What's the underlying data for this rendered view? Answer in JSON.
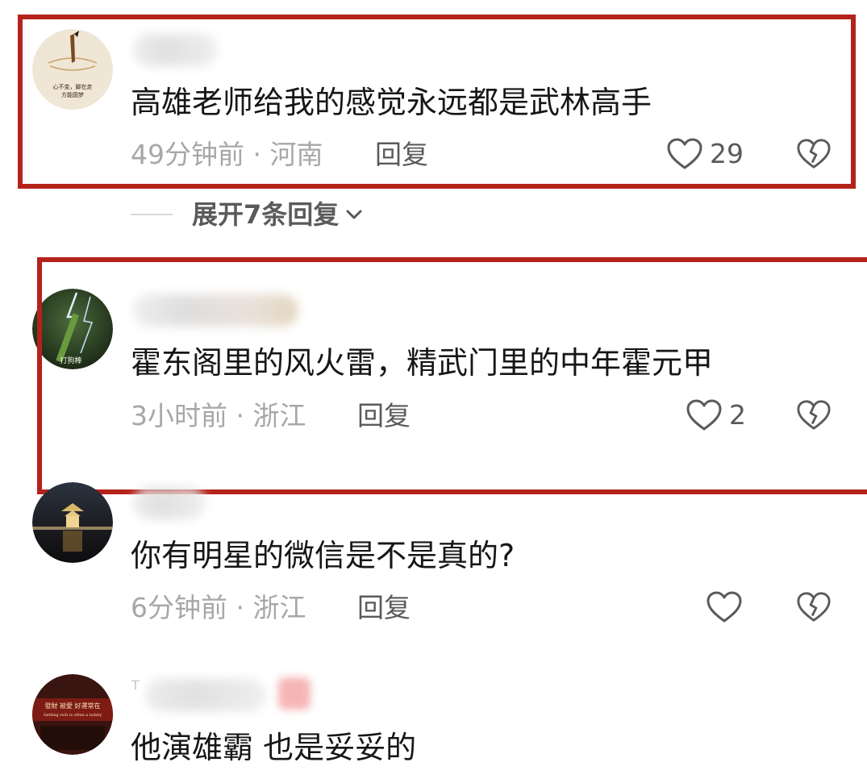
{
  "comments": [
    {
      "avatar_text": [
        "心不变，脚在走",
        "方能圆梦"
      ],
      "text": "高雄老师给我的感觉永远都是武林高手",
      "time": "49分钟前",
      "location": "河南",
      "reply_label": "回复",
      "likes": "29",
      "highlighted": true
    },
    {
      "avatar_text": [
        "打狗棒"
      ],
      "text": "霍东阁里的风火雷，精武门里的中年霍元甲",
      "time": "3小时前",
      "location": "浙江",
      "reply_label": "回复",
      "likes": "2",
      "highlighted": true
    },
    {
      "text": "你有明星的微信是不是真的?",
      "time": "6分钟前",
      "location": "浙江",
      "reply_label": "回复",
      "likes": "",
      "highlighted": false
    },
    {
      "avatar_text": [
        "發財 被愛 好運常在",
        "Getting rich is often a hobby"
      ],
      "username_visible": "T",
      "text": "他演雄霸 也是妥妥的",
      "highlighted": false
    }
  ],
  "expand_replies": {
    "label": "展开7条回复"
  },
  "meta_separator": " · ",
  "icons": {
    "like": "heart-outline-icon",
    "dislike": "broken-heart-icon",
    "expand": "chevron-down-icon"
  },
  "colors": {
    "highlight_border": "#b5221b",
    "meta_text": "#a7a7a7",
    "action_text": "#5a5a5a"
  }
}
